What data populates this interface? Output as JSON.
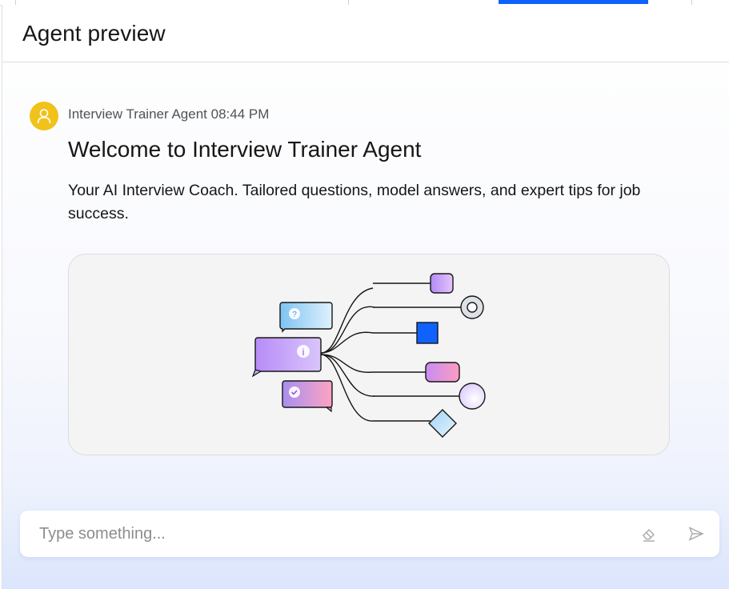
{
  "panel": {
    "title": "Agent preview"
  },
  "message": {
    "sender": "Interview Trainer Agent",
    "time": "08:44 PM",
    "title": "Welcome to Interview Trainer Agent",
    "body": "Your AI Interview Coach. Tailored questions, model answers, and expert tips for job success."
  },
  "icons": {
    "avatar": "user-icon",
    "clear": "eraser-icon",
    "send": "send-icon"
  },
  "input": {
    "placeholder": "Type something...",
    "value": ""
  },
  "colors": {
    "accent": "#0f62fe",
    "avatar_bg": "#f1c21b"
  }
}
